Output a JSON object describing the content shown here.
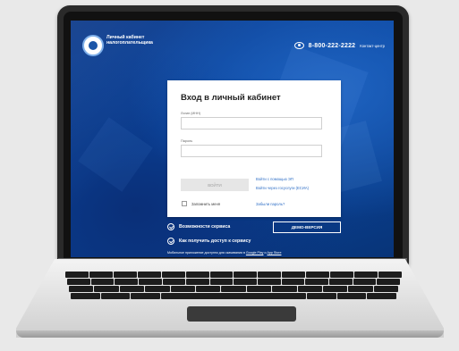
{
  "header": {
    "brand_line1": "Личный кабинет",
    "brand_line2": "налогоплательщика",
    "phone": "8-800-222-2222",
    "contact_label": "Контакт-центр"
  },
  "login": {
    "title": "Вход в личный кабинет",
    "login_label": "Логин (ИНН)",
    "password_label": "Пароль",
    "submit_label": "ВОЙТИ",
    "link_ep": "Войти с помощью ЭП",
    "link_esia": "Войти через госуслуги (ЕСИА)",
    "remember_label": "Запомнить меня",
    "forgot_label": "Забыли пароль?"
  },
  "bottom": {
    "features": "Возможности сервиса",
    "access": "Как получить доступ к сервису",
    "demo_label": "ДЕМО-ВЕРСИЯ",
    "mobile_prefix": "Мобильное приложение доступно для скачивания в",
    "google_play": "Google Play",
    "and": "и",
    "app_store": "App Store"
  },
  "colors": {
    "accent": "#1c56a8",
    "background_dark": "#0b3d8a",
    "link": "#2f6fc6"
  }
}
